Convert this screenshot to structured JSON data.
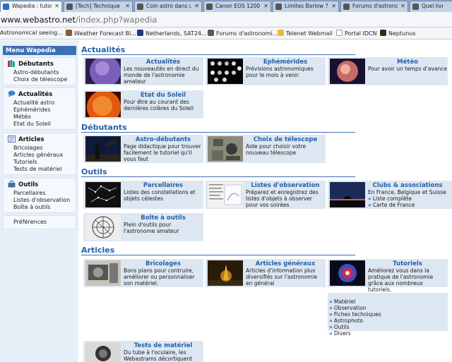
{
  "browser": {
    "tabs": [
      {
        "label": "Wapedia : tutor",
        "active": true
      },
      {
        "label": "[Tech] Technique",
        "active": false
      },
      {
        "label": "Coin astro dans u",
        "active": false
      },
      {
        "label": "Canon EOS 1200",
        "active": false
      },
      {
        "label": "Limites Barlow ?",
        "active": false
      },
      {
        "label": "Forums d'astrono",
        "active": false
      },
      {
        "label": "Quel livre av",
        "active": false
      }
    ],
    "address_host": "www.webastro.net",
    "address_path": "/index.php?wapedia",
    "bookmarks": [
      {
        "label": "Astronomical seeing..."
      },
      {
        "label": "Weather Forecast Bi..."
      },
      {
        "label": "Netherlands, SAT24..."
      },
      {
        "label": "Forums d'astronomi..."
      },
      {
        "label": "Telenet Webmail"
      },
      {
        "label": "Portal IDCN"
      },
      {
        "label": "Neptunus"
      }
    ]
  },
  "nav": {
    "menu_title": "Menu Wapedia",
    "groups": [
      {
        "title": "Débutants",
        "items": [
          "Astro-débutants",
          "Choix de télescope"
        ]
      },
      {
        "title": "Actualités",
        "items": [
          "Actualité astro",
          "Ephémérides",
          "Météo",
          "Etat du Soleil"
        ]
      },
      {
        "title": "Articles",
        "items": [
          "Bricolages",
          "Articles généraux",
          "Tutoriels",
          "Tests de matériel"
        ]
      },
      {
        "title": "Outils",
        "items": [
          "Parcellaires",
          "Listes d'observation",
          "Boîte à outils"
        ]
      }
    ],
    "preferences": "Préférences"
  },
  "sections": {
    "actualites": "Actualités",
    "debutants": "Débutants",
    "outils": "Outils",
    "articles": "Articles"
  },
  "cards": {
    "actualites": {
      "title": "Actualités",
      "desc": "Les nouveautés en direct du monde de l'astronomie amateur"
    },
    "ephemerides": {
      "title": "Ephémérides",
      "desc": "Prévisions astronomiques pour le mois à venir."
    },
    "meteo": {
      "title": "Météo",
      "desc": "Pour avoir un temps d'avance"
    },
    "soleil": {
      "title": "Etat du Soleil",
      "desc": "Pour être au courant des dernières colères du Soleil"
    },
    "astro_debutants": {
      "title": "Astro-débutants",
      "desc": "Page didactique pour trouver facilement le tutoriel qu'il vous faut"
    },
    "choix_telescope": {
      "title": "Choix de télescope",
      "desc": "Aide pour choisir votre nouveau télescope"
    },
    "parcellaires": {
      "title": "Parcellaires",
      "desc": "Listes des constellations et objets célestes"
    },
    "listes_observation": {
      "title": "Listes d'observation",
      "desc": "Préparez et enregistrez des listes d'objets à observer pour vos soirées"
    },
    "clubs": {
      "title": "Clubs & associations",
      "desc": "En France, Belgique et Suisse",
      "links": [
        "Liste complète",
        "Carte de France"
      ]
    },
    "boite_outils": {
      "title": "Boîte à outils",
      "desc": "Plein d'outils pour l'astronome amateur"
    },
    "bricolages": {
      "title": "Bricolages",
      "desc": "Bons plans pour contruire, améliorer ou personnaliser son matériel."
    },
    "articles_generaux": {
      "title": "Articles généraux",
      "desc": "Articles d'information plus diversifiés sur l'astronomie en général"
    },
    "tutoriels": {
      "title": "Tutoriels",
      "desc": "Améliorez vous dans la pratique de l'astronomie grâce aux nombreux tutoriels.",
      "links": [
        "Matériel",
        "Observation",
        "Fiches techniques",
        "Astrophoto",
        "Outils",
        "Divers"
      ]
    },
    "tests_materiel": {
      "title": "Tests de matériel",
      "desc": "Du tube à l'oculaire, les Webastrams décortiquent"
    }
  },
  "colors": {
    "accent": "#2561a9",
    "nav_background": "#e7eff8",
    "card_background": "#dde7f2",
    "menu_header": "#3d6fb4"
  }
}
